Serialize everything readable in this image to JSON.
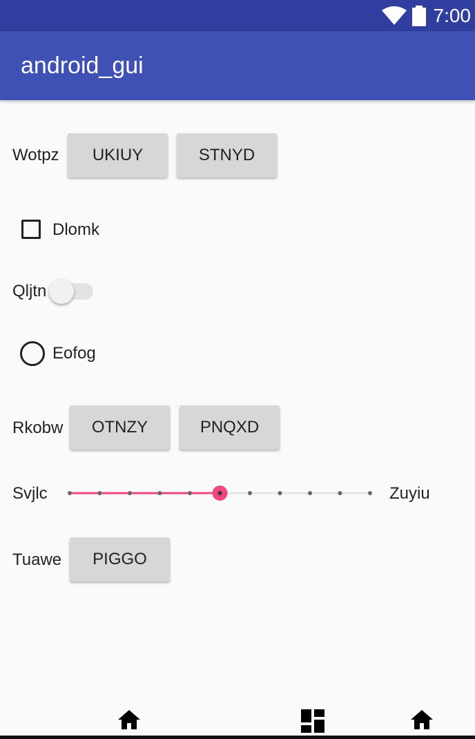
{
  "status_bar": {
    "time": "7:00",
    "icons": [
      "wifi-icon",
      "battery-icon"
    ]
  },
  "app_bar": {
    "title": "android_gui"
  },
  "rows": {
    "row1": {
      "label": "Wotpz",
      "button1": "UKIUY",
      "button2": "STNYD"
    },
    "checkbox": {
      "label": "Dlomk",
      "checked": false
    },
    "switch": {
      "label": "Qljtn",
      "on": false
    },
    "radio": {
      "label": "Eofog",
      "selected": false
    },
    "row2": {
      "label": "Rkobw",
      "button1": "OTNZY",
      "button2": "PNQXD"
    },
    "seekbar": {
      "label_left": "Svjlc",
      "label_right": "Zuyiu",
      "value": 5,
      "max": 10
    },
    "row3": {
      "label": "Tuawe",
      "button1": "PIGGO"
    }
  },
  "nav_bar": {
    "icons": [
      "home-icon",
      "dashboard-icon",
      "home-icon"
    ]
  },
  "colors": {
    "status_bar": "#303f9f",
    "app_bar": "#3f51b5",
    "accent": "#f0487e",
    "background": "#fafafa",
    "button": "#d6d7d7"
  }
}
